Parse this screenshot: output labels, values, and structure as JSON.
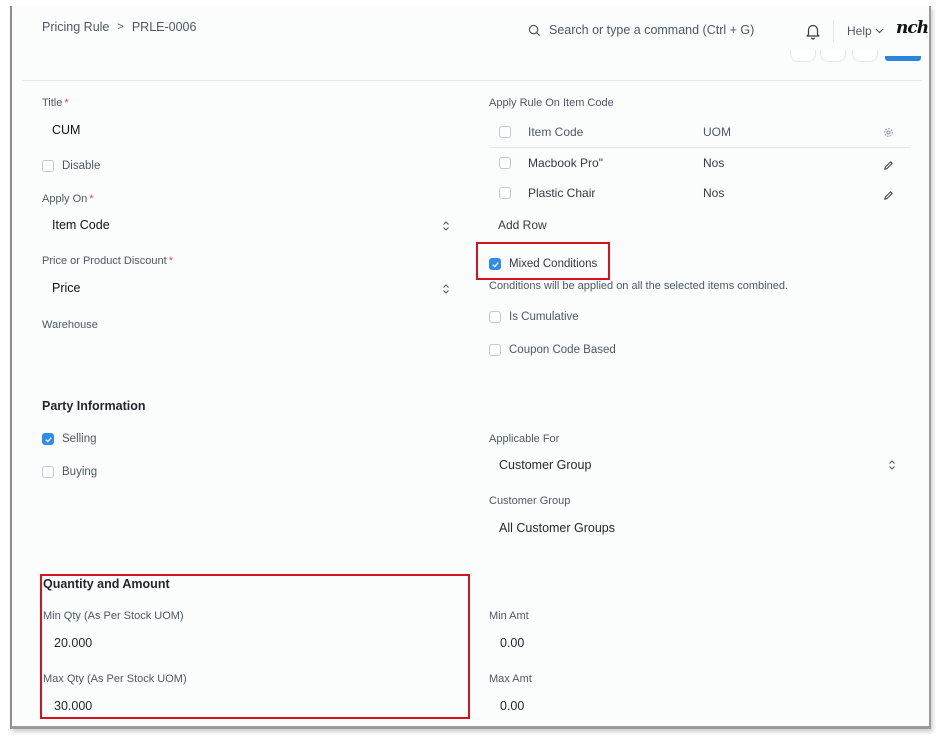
{
  "header": {
    "breadcrumb": [
      "Pricing Rule",
      "PRLE-0006"
    ],
    "breadcrumb_separator": ">",
    "search_placeholder": "Search or type a command (Ctrl + G)",
    "help_label": "Help",
    "avatar_signature": "nch"
  },
  "left": {
    "title": {
      "label": "Title",
      "required": "*",
      "value": "CUM"
    },
    "disable": {
      "label": "Disable",
      "checked": false
    },
    "apply_on": {
      "label": "Apply On",
      "required": "*",
      "value": "Item Code"
    },
    "price_or_product_discount": {
      "label": "Price or Product Discount",
      "required": "*",
      "value": "Price"
    },
    "warehouse": {
      "label": "Warehouse",
      "value": ""
    }
  },
  "right": {
    "apply_rule_on_item_code": {
      "label": "Apply Rule On Item Code",
      "columns": [
        "Item Code",
        "UOM"
      ],
      "rows": [
        {
          "item_code": "Macbook Pro\"",
          "uom": "Nos"
        },
        {
          "item_code": "Plastic Chair",
          "uom": "Nos"
        }
      ],
      "add_row_label": "Add Row"
    },
    "mixed_conditions": {
      "label": "Mixed Conditions",
      "checked": true,
      "description": "Conditions will be applied on all the selected items combined."
    },
    "is_cumulative": {
      "label": "Is Cumulative",
      "checked": false
    },
    "coupon_code_based": {
      "label": "Coupon Code Based",
      "checked": false
    }
  },
  "party_information": {
    "title": "Party Information",
    "selling": {
      "label": "Selling",
      "checked": true
    },
    "buying": {
      "label": "Buying",
      "checked": false
    },
    "applicable_for": {
      "label": "Applicable For",
      "value": "Customer Group"
    },
    "customer_group": {
      "label": "Customer Group",
      "value": "All Customer Groups"
    }
  },
  "quantity_and_amount": {
    "title": "Quantity and Amount",
    "min_qty": {
      "label": "Min Qty (As Per Stock UOM)",
      "value": "20.000"
    },
    "max_qty": {
      "label": "Max Qty (As Per Stock UOM)",
      "value": "30.000"
    },
    "min_amt": {
      "label": "Min Amt",
      "value": "0.00"
    },
    "max_amt": {
      "label": "Max Amt",
      "value": "0.00"
    }
  },
  "colors": {
    "accent": "#2f8ceb",
    "primary_button": "#2a84e0",
    "highlight_box": "#d7121f",
    "required_asterisk": "#e24c4c"
  }
}
